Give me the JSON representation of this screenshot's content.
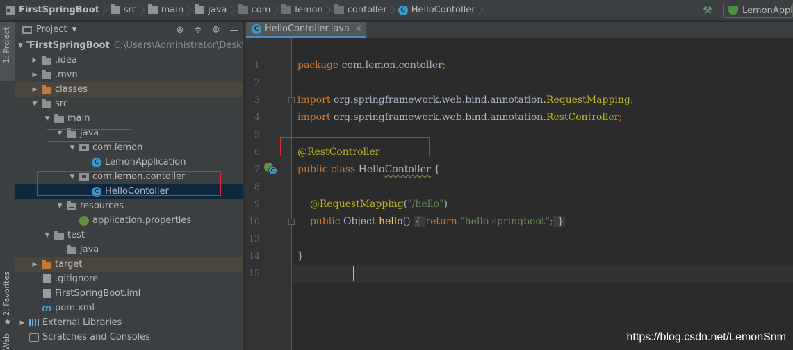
{
  "navbar": {
    "crumbs": [
      {
        "label": "FirstSpringBoot",
        "icon": "project-icon"
      },
      {
        "label": "src",
        "icon": "folder-icon"
      },
      {
        "label": "main",
        "icon": "folder-icon"
      },
      {
        "label": "java",
        "icon": "folder-icon"
      },
      {
        "label": "com",
        "icon": "package-icon"
      },
      {
        "label": "lemon",
        "icon": "package-icon"
      },
      {
        "label": "contoller",
        "icon": "package-icon"
      },
      {
        "label": "HelloContoller",
        "icon": "class-icon"
      }
    ],
    "run_config": "LemonApplication",
    "build_icon": "hammer-icon"
  },
  "side_tabs": {
    "project": "1: Project",
    "favorites": "2: Favorites",
    "structure": "Web"
  },
  "panel": {
    "title": "Project",
    "tools": [
      "target-icon",
      "collapse-icon",
      "gear-icon",
      "hide-icon"
    ]
  },
  "tree": [
    {
      "label": "FirstSpringBoot",
      "path": "C:\\Users\\Administrator\\Desktop\\",
      "depth": 0,
      "toggle": "open",
      "icon": "module-folder"
    },
    {
      "label": ".idea",
      "depth": 1,
      "toggle": "closed",
      "icon": "folder"
    },
    {
      "label": ".mvn",
      "depth": 1,
      "toggle": "closed",
      "icon": "folder"
    },
    {
      "label": "classes",
      "depth": 1,
      "toggle": "closed",
      "icon": "excluded-folder"
    },
    {
      "label": "src",
      "depth": 1,
      "toggle": "open",
      "icon": "folder"
    },
    {
      "label": "main",
      "depth": 2,
      "toggle": "open",
      "icon": "folder"
    },
    {
      "label": "java",
      "depth": 3,
      "toggle": "open",
      "icon": "source-folder"
    },
    {
      "label": "com.lemon",
      "depth": 4,
      "toggle": "open",
      "icon": "package"
    },
    {
      "label": "LemonApplication",
      "depth": 5,
      "toggle": "none",
      "icon": "spring-class"
    },
    {
      "label": "com.lemon.contoller",
      "depth": 4,
      "toggle": "open",
      "icon": "package"
    },
    {
      "label": "HelloContoller",
      "depth": 5,
      "toggle": "none",
      "icon": "class",
      "selected": true
    },
    {
      "label": "resources",
      "depth": 3,
      "toggle": "open",
      "icon": "resources-folder"
    },
    {
      "label": "application.properties",
      "depth": 4,
      "toggle": "none",
      "icon": "spring-properties"
    },
    {
      "label": "test",
      "depth": 2,
      "toggle": "open",
      "icon": "folder"
    },
    {
      "label": "java",
      "depth": 3,
      "toggle": "none",
      "icon": "folder"
    },
    {
      "label": "target",
      "depth": 1,
      "toggle": "closed",
      "icon": "excluded-folder"
    },
    {
      "label": ".gitignore",
      "depth": 1,
      "toggle": "none",
      "icon": "file"
    },
    {
      "label": "FirstSpringBoot.iml",
      "depth": 1,
      "toggle": "none",
      "icon": "file"
    },
    {
      "label": "pom.xml",
      "depth": 1,
      "toggle": "none",
      "icon": "maven"
    },
    {
      "label": "External Libraries",
      "depth": 0,
      "toggle": "closed",
      "icon": "libraries"
    },
    {
      "label": "Scratches and Consoles",
      "depth": 0,
      "toggle": "none",
      "icon": "scratch"
    }
  ],
  "editor": {
    "tab": "HelloContoller.java",
    "lines": [
      {
        "n": "1",
        "tokens": [
          [
            "kw",
            "package "
          ],
          [
            "",
            "com.lemon.contoller"
          ],
          [
            "kw",
            ";"
          ]
        ]
      },
      {
        "n": "2",
        "tokens": []
      },
      {
        "n": "3",
        "tokens": [
          [
            "kw",
            "import "
          ],
          [
            "",
            "org.springframework.web.bind.annotation."
          ],
          [
            "ann",
            "RequestMapping"
          ],
          [
            "kw",
            ";"
          ]
        ]
      },
      {
        "n": "4",
        "tokens": [
          [
            "kw",
            "import "
          ],
          [
            "",
            "org.springframework.web.bind.annotation."
          ],
          [
            "ann",
            "RestController"
          ],
          [
            "kw",
            ";"
          ]
        ]
      },
      {
        "n": "5",
        "tokens": []
      },
      {
        "n": "6",
        "tokens": [
          [
            "ann",
            "@RestController"
          ]
        ]
      },
      {
        "n": "7",
        "tokens": [
          [
            "kw",
            "public class "
          ],
          [
            "",
            "Hello"
          ],
          [
            "wavy",
            "Contoller"
          ],
          [
            "",
            " {"
          ]
        ]
      },
      {
        "n": "8",
        "tokens": []
      },
      {
        "n": "9",
        "tokens": [
          [
            "",
            "    "
          ],
          [
            "ann",
            "@RequestMapping"
          ],
          [
            "",
            "("
          ],
          [
            "str",
            "\"/hello\""
          ],
          [
            "",
            ")"
          ]
        ]
      },
      {
        "n": "10",
        "tokens": [
          [
            "",
            "    "
          ],
          [
            "kw",
            "public "
          ],
          [
            "",
            "Object "
          ],
          [
            "fn",
            "hello"
          ],
          [
            "",
            "() "
          ],
          [
            "brace",
            "{ "
          ],
          [
            "kw",
            "return "
          ],
          [
            "str",
            "\"hello springboot\""
          ],
          [
            "kw",
            ";"
          ],
          [
            "brace",
            " }"
          ]
        ]
      },
      {
        "n": "13",
        "tokens": []
      },
      {
        "n": "14",
        "tokens": [
          [
            "",
            "}"
          ]
        ]
      },
      {
        "n": "15",
        "tokens": []
      }
    ]
  },
  "watermark": "https://blog.csdn.net/LemonSnm"
}
